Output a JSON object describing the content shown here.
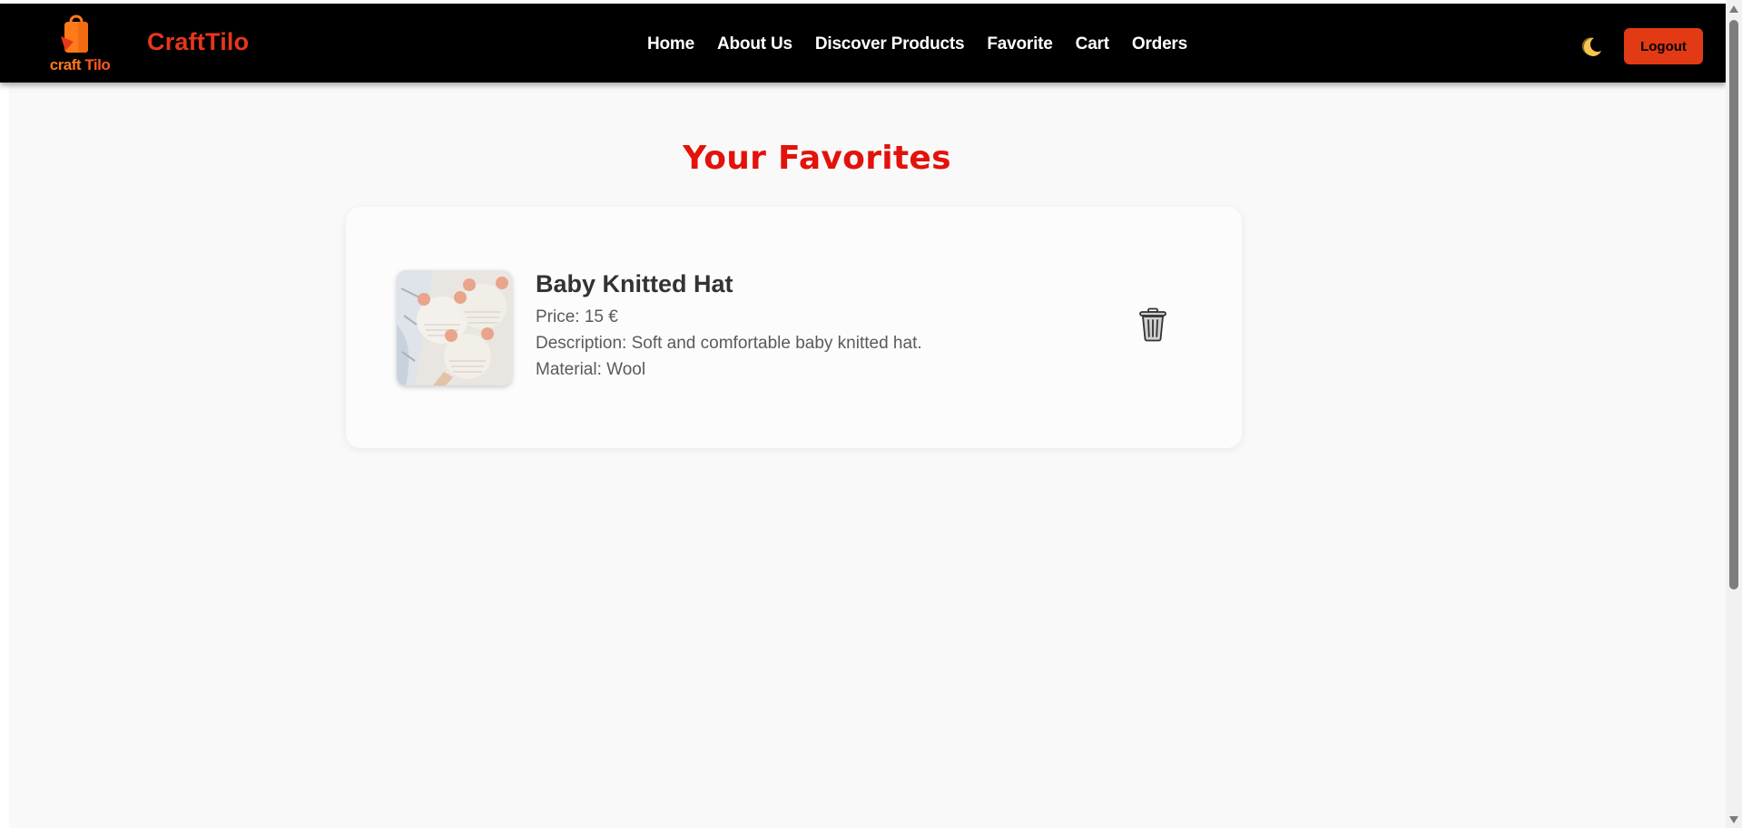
{
  "navbar": {
    "logo_text_craft": "craft",
    "logo_text_tilo": "Tilo",
    "brand": "CraftTilo",
    "links": [
      {
        "label": "Home"
      },
      {
        "label": "About Us"
      },
      {
        "label": "Discover Products"
      },
      {
        "label": "Favorite"
      },
      {
        "label": "Cart"
      },
      {
        "label": "Orders"
      }
    ],
    "theme_icon": "moon-icon",
    "logout_label": "Logout"
  },
  "main": {
    "heading": "Your Favorites",
    "favorites": [
      {
        "title": "Baby Knitted Hat",
        "price": "Price: 15 €",
        "description": "Description: Soft and comfortable baby knitted hat.",
        "material": "Material: Wool",
        "remove_icon": "trash-icon"
      }
    ]
  },
  "colors": {
    "accent": "#e3120b",
    "logout": "#e23a14",
    "navbar_bg": "#000000",
    "page_bg": "#f9f9f9"
  }
}
